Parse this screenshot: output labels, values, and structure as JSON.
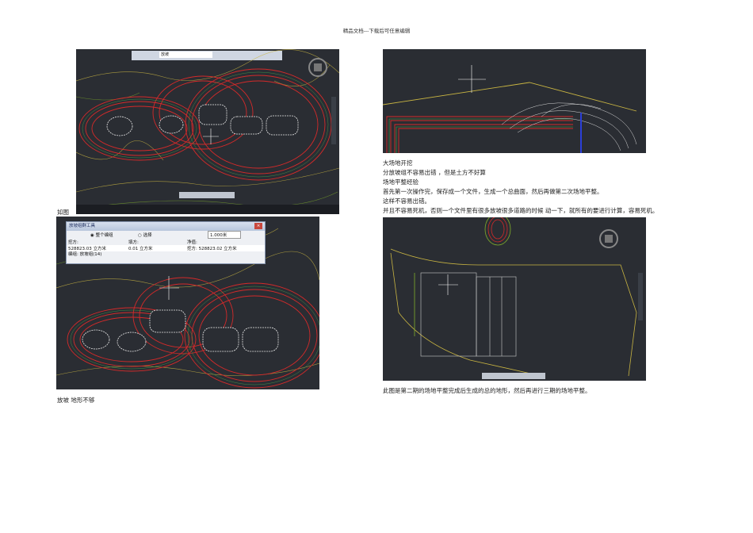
{
  "header": {
    "text": "精品文档---下载后可任意编辑"
  },
  "left": {
    "caption_top_prefix": "如图",
    "caption_bottom": "放坡  地形不够",
    "dialog": {
      "title": "放坡组群工具",
      "radio_all": "整个编组",
      "radio_select": "选择",
      "factor": "1.000米",
      "col_cut": "挖方:",
      "col_fill": "填方:",
      "col_net": "净值:",
      "cut_value": "528823.03 立方米",
      "fill_value": "0.01 立方米",
      "net_value": "挖方: 528823.02 立方米",
      "group": "编组: 放坡组(14)"
    },
    "shot1_search": "放坡"
  },
  "right": {
    "lines": [
      "大场地开挖",
      "分放坡组不容易出错 ，但是土方不好算",
      "场地平整经验",
      "首先第一次操作完，保存成一个文件，生成一个总曲面，然后再做第二次场地平整。",
      "这样不容易出错。",
      "并且不容易死机，否则一个文件里有很多放坡很多道路的时候 动一下，就所有的要进行计算，容易死机。"
    ],
    "caption_bottom": "此图是第二期的场地平整完成后生成的总的地形，然后再进行三期的场地平整。"
  },
  "colors": {
    "cad_bg": "#262a31",
    "contour_red": "#d42a2a",
    "contour_green": "#7fae2a",
    "contour_yellow": "#c9b542",
    "boundary_white": "#e8e8e8"
  }
}
